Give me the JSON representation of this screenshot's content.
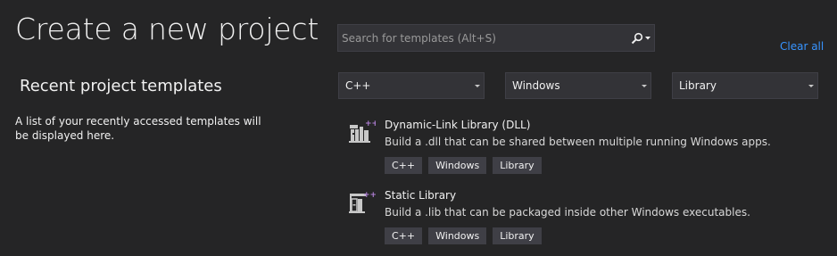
{
  "header": {
    "title": "Create a new project"
  },
  "recent": {
    "heading": "Recent project templates",
    "empty_message": "A list of your recently accessed templates will be displayed here."
  },
  "search": {
    "placeholder": "Search for templates (Alt+S)",
    "value": ""
  },
  "clear_all_label": "Clear all",
  "filters": {
    "language": "C++",
    "platform": "Windows",
    "project_type": "Library"
  },
  "templates": [
    {
      "name": "Dynamic-Link Library (DLL)",
      "description": "Build a .dll that can be shared between multiple running Windows apps.",
      "tags": [
        "C++",
        "Windows",
        "Library"
      ]
    },
    {
      "name": "Static Library",
      "description": "Build a .lib that can be packaged inside other Windows executables.",
      "tags": [
        "C++",
        "Windows",
        "Library"
      ]
    }
  ],
  "colors": {
    "background": "#252526",
    "input_background": "#333337",
    "link": "#3794ff",
    "tag_background": "#3f3f46",
    "cpp_badge": "#b180d7"
  }
}
